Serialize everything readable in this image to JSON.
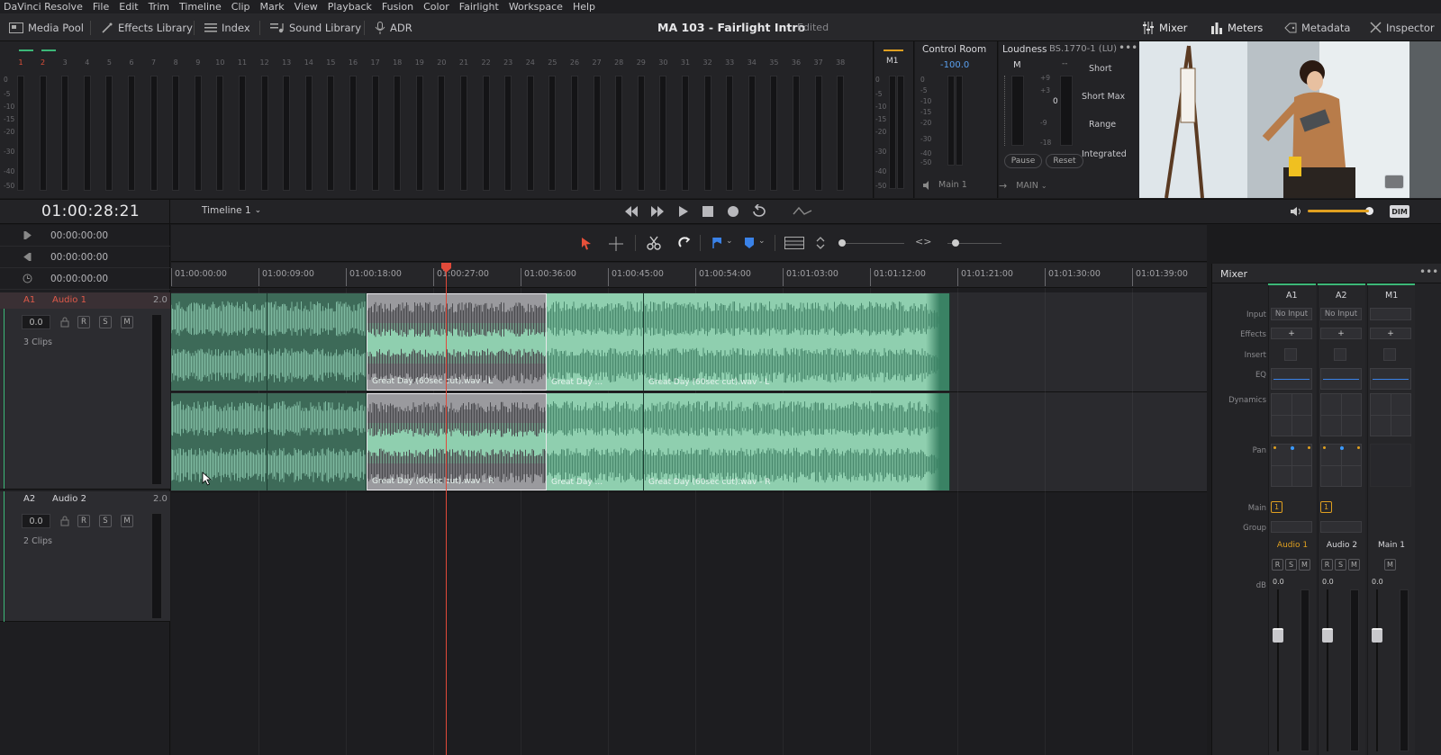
{
  "menu": [
    "DaVinci Resolve",
    "File",
    "Edit",
    "Trim",
    "Timeline",
    "Clip",
    "Mark",
    "View",
    "Playback",
    "Fusion",
    "Color",
    "Fairlight",
    "Workspace",
    "Help"
  ],
  "toolbar": {
    "media_pool": "Media Pool",
    "effects_library": "Effects Library",
    "index": "Index",
    "sound_library": "Sound Library",
    "adr": "ADR",
    "project_title": "MA 103 - Fairlight Intro",
    "edited": "Edited",
    "mixer": "Mixer",
    "meters": "Meters",
    "metadata": "Metadata",
    "inspector": "Inspector"
  },
  "meters": {
    "channel_numbers": [
      "1",
      "2",
      "3",
      "4",
      "5",
      "6",
      "7",
      "8",
      "9",
      "10",
      "11",
      "12",
      "13",
      "14",
      "15",
      "16",
      "17",
      "18",
      "19",
      "20",
      "21",
      "22",
      "23",
      "24",
      "25",
      "26",
      "27",
      "28",
      "29",
      "30",
      "31",
      "32",
      "33",
      "34",
      "35",
      "36",
      "37",
      "38"
    ],
    "scale": [
      "0",
      "-5",
      "-10",
      "-15",
      "-20",
      "-30",
      "-40",
      "-50"
    ],
    "m1_label": "M1"
  },
  "control_room": {
    "title": "Control Room",
    "value": "-100.0",
    "scale": [
      "0",
      "-5",
      "-10",
      "-15",
      "-20",
      "-30",
      "-40",
      "-50"
    ],
    "output": "Main 1"
  },
  "loudness": {
    "title": "Loudness",
    "standard": "BS.1770-1 (LU)",
    "m_label": "M",
    "short": "Short",
    "short_max": "Short Max",
    "range": "Range",
    "integrated": "Integrated",
    "pause": "Pause",
    "reset": "Reset",
    "main_label": "MAIN",
    "dash": "--",
    "zero": "0",
    "scale": [
      "+9",
      "+3",
      "0",
      "-9",
      "-18"
    ]
  },
  "transport": {
    "timecode": "01:00:28:21",
    "timeline_name": "Timeline 1",
    "dim": "DIM"
  },
  "timecodes": [
    "00:00:00:00",
    "00:00:00:00",
    "00:00:00:00"
  ],
  "ruler": [
    "01:00:00:00",
    "01:00:09:00",
    "01:00:18:00",
    "01:00:27:00",
    "01:00:36:00",
    "01:00:45:00",
    "01:00:54:00",
    "01:01:03:00",
    "01:01:12:00",
    "01:01:21:00",
    "01:01:30:00",
    "01:01:39:00"
  ],
  "tracks": [
    {
      "id": "A1",
      "name": "Audio 1",
      "format": "2.0",
      "volume": "0.0",
      "clips": "3 Clips"
    },
    {
      "id": "A2",
      "name": "Audio 2",
      "format": "2.0",
      "volume": "0.0",
      "clips": "2 Clips"
    }
  ],
  "track_buttons": {
    "r": "R",
    "s": "S",
    "m": "M"
  },
  "clip_labels": {
    "selected_l": "Great Day (60sec cut).wav - L",
    "selected_r": "Great Day (60sec cut).wav - R",
    "mid_l": "Great Day ...",
    "mid_r": "Great Day ...",
    "last_l": "Great Day (60sec cut).wav - L",
    "last_r": "Great Day (60sec cut).wav - R"
  },
  "mixer": {
    "title": "Mixer",
    "row_labels": [
      "Input",
      "Effects",
      "Insert",
      "EQ",
      "Dynamics",
      "Pan",
      "Main",
      "Group",
      "dB"
    ],
    "channels": [
      {
        "id": "A1",
        "input": "No Input",
        "name": "Audio 1",
        "db": "0.0"
      },
      {
        "id": "A2",
        "input": "No Input",
        "name": "Audio 2",
        "db": "0.0"
      },
      {
        "id": "M1",
        "input": "",
        "name": "Main 1",
        "db": "0.0"
      }
    ],
    "main_value": "1",
    "plus": "+"
  },
  "colors": {
    "accent_orange": "#e0a020",
    "playhead": "#e04a3a",
    "clip_green": "#8fcfaf",
    "clip_dark_green": "#4a8a6e",
    "selected_gray": "#9a9a9e"
  }
}
